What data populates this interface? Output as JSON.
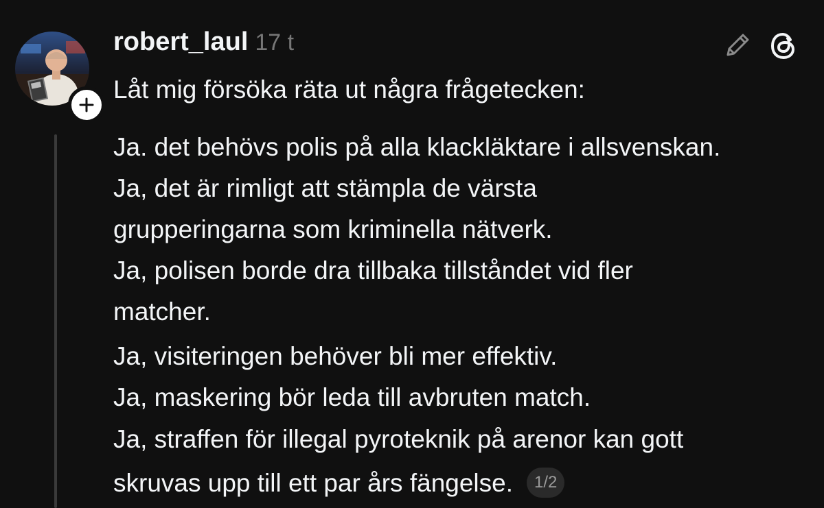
{
  "post": {
    "username": "robert_laul",
    "timestamp": "17 t",
    "follow_symbol": "+",
    "lines": [
      "Låt mig försöka räta ut några frågetecken:",
      "Ja. det behövs polis på alla klackläktare i allsvenskan.",
      "Ja, det är rimligt att stämpla de värsta",
      "grupperingarna som kriminella nätverk.",
      "Ja, polisen borde dra tillbaka tillståndet vid fler",
      "matcher.",
      "Ja, visiteringen behöver bli mer effektiv.",
      "Ja, maskering bör leda till avbruten match.",
      "Ja, straffen för illegal pyroteknik på arenor kan gott",
      "skruvas upp till ett par års fängelse."
    ],
    "page_indicator": "1/2"
  },
  "icons": {
    "edit": "pencil-icon",
    "app": "threads-logo-icon",
    "follow": "plus-icon"
  },
  "colors": {
    "background": "#101010",
    "text": "#f3f5f7",
    "muted": "#777777",
    "thread_line": "#3a3a3a"
  }
}
